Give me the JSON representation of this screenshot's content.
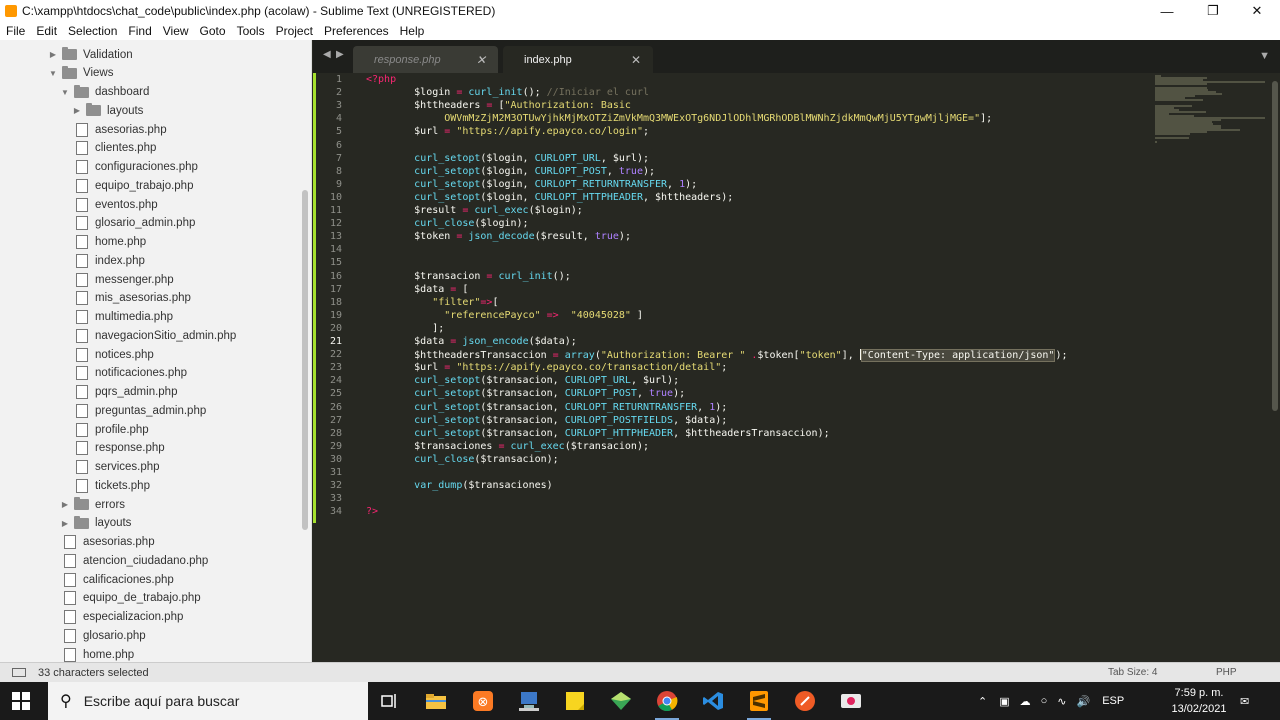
{
  "window": {
    "title": "C:\\xampp\\htdocs\\chat_code\\public\\index.php (acolaw) - Sublime Text (UNREGISTERED)"
  },
  "menu": [
    "File",
    "Edit",
    "Selection",
    "Find",
    "View",
    "Goto",
    "Tools",
    "Project",
    "Preferences",
    "Help"
  ],
  "sidebar": {
    "tree": [
      {
        "label": "Validation",
        "kind": "folder",
        "state": "collapsed"
      },
      {
        "label": "Views",
        "kind": "folder",
        "state": "expanded"
      },
      {
        "label": "dashboard",
        "kind": "folder",
        "state": "expanded"
      },
      {
        "label": "layouts",
        "kind": "folder",
        "state": "collapsed"
      },
      {
        "label": "asesorias.php",
        "kind": "file"
      },
      {
        "label": "clientes.php",
        "kind": "file"
      },
      {
        "label": "configuraciones.php",
        "kind": "file"
      },
      {
        "label": "equipo_trabajo.php",
        "kind": "file"
      },
      {
        "label": "eventos.php",
        "kind": "file"
      },
      {
        "label": "glosario_admin.php",
        "kind": "file"
      },
      {
        "label": "home.php",
        "kind": "file"
      },
      {
        "label": "index.php",
        "kind": "file"
      },
      {
        "label": "messenger.php",
        "kind": "file"
      },
      {
        "label": "mis_asesorias.php",
        "kind": "file"
      },
      {
        "label": "multimedia.php",
        "kind": "file"
      },
      {
        "label": "navegacionSitio_admin.php",
        "kind": "file"
      },
      {
        "label": "notices.php",
        "kind": "file"
      },
      {
        "label": "notificaciones.php",
        "kind": "file"
      },
      {
        "label": "pqrs_admin.php",
        "kind": "file"
      },
      {
        "label": "preguntas_admin.php",
        "kind": "file"
      },
      {
        "label": "profile.php",
        "kind": "file"
      },
      {
        "label": "response.php",
        "kind": "file"
      },
      {
        "label": "services.php",
        "kind": "file"
      },
      {
        "label": "tickets.php",
        "kind": "file"
      },
      {
        "label": "errors",
        "kind": "folder",
        "state": "collapsed"
      },
      {
        "label": "layouts",
        "kind": "folder",
        "state": "collapsed"
      },
      {
        "label": "asesorias.php",
        "kind": "file"
      },
      {
        "label": "atencion_ciudadano.php",
        "kind": "file"
      },
      {
        "label": "calificaciones.php",
        "kind": "file"
      },
      {
        "label": "equipo_de_trabajo.php",
        "kind": "file"
      },
      {
        "label": "especializacion.php",
        "kind": "file"
      },
      {
        "label": "glosario.php",
        "kind": "file"
      },
      {
        "label": "home.php",
        "kind": "file"
      }
    ]
  },
  "tabs": [
    {
      "label": "response.php",
      "active": false
    },
    {
      "label": "index.php",
      "active": true
    }
  ],
  "editor": {
    "current_line": 21,
    "lines": [
      [
        [
          "op",
          "<?php"
        ]
      ],
      [
        [
          "v",
          "        $login "
        ],
        [
          "op",
          "="
        ],
        [
          "v",
          " "
        ],
        [
          "fn",
          "curl_init"
        ],
        [
          "v",
          "(); "
        ],
        [
          "cm",
          "//Iniciar el curl"
        ]
      ],
      [
        [
          "v",
          "        $httheaders "
        ],
        [
          "op",
          "="
        ],
        [
          "v",
          " ["
        ],
        [
          "st",
          "\"Authorization: Basic"
        ]
      ],
      [
        [
          "st",
          "             OWVmMzZjM2M3OTUwYjhkMjMxOTZiZmVkMmQ3MWExOTg6NDJlODhlMGRhODBlMWNhZjdkMmQwMjU5YTgwMjljMGE=\""
        ],
        [
          "v",
          "];"
        ]
      ],
      [
        [
          "v",
          "        $url "
        ],
        [
          "op",
          "="
        ],
        [
          "v",
          " "
        ],
        [
          "st",
          "\"https://apify.epayco.co/login\""
        ],
        [
          "v",
          ";"
        ]
      ],
      [],
      [
        [
          "v",
          "        "
        ],
        [
          "fn",
          "curl_setopt"
        ],
        [
          "v",
          "($login, "
        ],
        [
          "fn",
          "CURLOPT_URL"
        ],
        [
          "v",
          ", $url);"
        ]
      ],
      [
        [
          "v",
          "        "
        ],
        [
          "fn",
          "curl_setopt"
        ],
        [
          "v",
          "($login, "
        ],
        [
          "fn",
          "CURLOPT_POST"
        ],
        [
          "v",
          ", "
        ],
        [
          "nm",
          "true"
        ],
        [
          "v",
          ");"
        ]
      ],
      [
        [
          "v",
          "        "
        ],
        [
          "fn",
          "curl_setopt"
        ],
        [
          "v",
          "($login, "
        ],
        [
          "fn",
          "CURLOPT_RETURNTRANSFER"
        ],
        [
          "v",
          ", "
        ],
        [
          "nm",
          "1"
        ],
        [
          "v",
          ");"
        ]
      ],
      [
        [
          "v",
          "        "
        ],
        [
          "fn",
          "curl_setopt"
        ],
        [
          "v",
          "($login, "
        ],
        [
          "fn",
          "CURLOPT_HTTPHEADER"
        ],
        [
          "v",
          ", $httheaders);"
        ]
      ],
      [
        [
          "v",
          "        $result "
        ],
        [
          "op",
          "="
        ],
        [
          "v",
          " "
        ],
        [
          "fn",
          "curl_exec"
        ],
        [
          "v",
          "($login);"
        ]
      ],
      [
        [
          "v",
          "        "
        ],
        [
          "fn",
          "curl_close"
        ],
        [
          "v",
          "($login);"
        ]
      ],
      [
        [
          "v",
          "        $token "
        ],
        [
          "op",
          "="
        ],
        [
          "v",
          " "
        ],
        [
          "fn",
          "json_decode"
        ],
        [
          "v",
          "($result, "
        ],
        [
          "nm",
          "true"
        ],
        [
          "v",
          ");"
        ]
      ],
      [],
      [],
      [
        [
          "v",
          "        $transacion "
        ],
        [
          "op",
          "="
        ],
        [
          "v",
          " "
        ],
        [
          "fn",
          "curl_init"
        ],
        [
          "v",
          "();"
        ]
      ],
      [
        [
          "v",
          "        $data "
        ],
        [
          "op",
          "="
        ],
        [
          "v",
          " ["
        ]
      ],
      [
        [
          "v",
          "           "
        ],
        [
          "st",
          "\"filter\""
        ],
        [
          "op",
          "=>"
        ],
        [
          "v",
          "["
        ]
      ],
      [
        [
          "v",
          "             "
        ],
        [
          "st",
          "\"referencePayco\""
        ],
        [
          "v",
          " "
        ],
        [
          "op",
          "=>"
        ],
        [
          "v",
          "  "
        ],
        [
          "st",
          "\"40045028\""
        ],
        [
          "v",
          " ]"
        ]
      ],
      [
        [
          "v",
          "           ];"
        ]
      ],
      [
        [
          "v",
          "        $data "
        ],
        [
          "op",
          "="
        ],
        [
          "v",
          " "
        ],
        [
          "fn",
          "json_encode"
        ],
        [
          "v",
          "($data);"
        ]
      ],
      [
        [
          "v",
          "        $httheadersTransaccion "
        ],
        [
          "op",
          "="
        ],
        [
          "v",
          " "
        ],
        [
          "fn",
          "array"
        ],
        [
          "v",
          "("
        ],
        [
          "st",
          "\"Authorization: Bearer \""
        ],
        [
          "v",
          " "
        ],
        [
          "op",
          "."
        ],
        [
          "v",
          "$token["
        ],
        [
          "st",
          "\"token\""
        ],
        [
          "v",
          "], "
        ],
        [
          "caret",
          ""
        ],
        [
          "sel",
          "\"Content-Type: application/json\""
        ],
        [
          "v",
          ");"
        ]
      ],
      [
        [
          "v",
          "        $url "
        ],
        [
          "op",
          "="
        ],
        [
          "v",
          " "
        ],
        [
          "st",
          "\"https://apify.epayco.co/transaction/detail\""
        ],
        [
          "v",
          ";"
        ]
      ],
      [
        [
          "v",
          "        "
        ],
        [
          "fn",
          "curl_setopt"
        ],
        [
          "v",
          "($transacion, "
        ],
        [
          "fn",
          "CURLOPT_URL"
        ],
        [
          "v",
          ", $url);"
        ]
      ],
      [
        [
          "v",
          "        "
        ],
        [
          "fn",
          "curl_setopt"
        ],
        [
          "v",
          "($transacion, "
        ],
        [
          "fn",
          "CURLOPT_POST"
        ],
        [
          "v",
          ", "
        ],
        [
          "nm",
          "true"
        ],
        [
          "v",
          ");"
        ]
      ],
      [
        [
          "v",
          "        "
        ],
        [
          "fn",
          "curl_setopt"
        ],
        [
          "v",
          "($transacion, "
        ],
        [
          "fn",
          "CURLOPT_RETURNTRANSFER"
        ],
        [
          "v",
          ", "
        ],
        [
          "nm",
          "1"
        ],
        [
          "v",
          ");"
        ]
      ],
      [
        [
          "v",
          "        "
        ],
        [
          "fn",
          "curl_setopt"
        ],
        [
          "v",
          "($transacion, "
        ],
        [
          "fn",
          "CURLOPT_POSTFIELDS"
        ],
        [
          "v",
          ", $data);"
        ]
      ],
      [
        [
          "v",
          "        "
        ],
        [
          "fn",
          "curl_setopt"
        ],
        [
          "v",
          "($transacion, "
        ],
        [
          "fn",
          "CURLOPT_HTTPHEADER"
        ],
        [
          "v",
          ", $httheadersTransaccion);"
        ]
      ],
      [
        [
          "v",
          "        $transaciones "
        ],
        [
          "op",
          "="
        ],
        [
          "v",
          " "
        ],
        [
          "fn",
          "curl_exec"
        ],
        [
          "v",
          "($transacion);"
        ]
      ],
      [
        [
          "v",
          "        "
        ],
        [
          "fn",
          "curl_close"
        ],
        [
          "v",
          "($transacion);"
        ]
      ],
      [],
      [
        [
          "v",
          "        "
        ],
        [
          "fn",
          "var_dump"
        ],
        [
          "v",
          "($transaciones)"
        ]
      ],
      [],
      [
        [
          "op",
          "?>"
        ]
      ]
    ]
  },
  "status": {
    "selection": "33 characters selected",
    "tab_size": "Tab Size: 4",
    "syntax": "PHP"
  },
  "taskbar": {
    "search_placeholder": "Escribe aquí para buscar",
    "apps": [
      "task-view",
      "file-explorer",
      "xampp",
      "network-app",
      "sticky-notes",
      "sketchup",
      "chrome",
      "vscode",
      "sublime-text",
      "postman",
      "screen-recorder"
    ],
    "language": "ESP",
    "time": "7:59 p. m.",
    "date": "13/02/2021"
  },
  "colors": {
    "keyword": "#f92672",
    "function": "#66d9ef",
    "string": "#e6db74",
    "number": "#ae81ff",
    "comment": "#75715e",
    "text": "#f8f8f2",
    "modified_marker": "#a6e22e"
  }
}
